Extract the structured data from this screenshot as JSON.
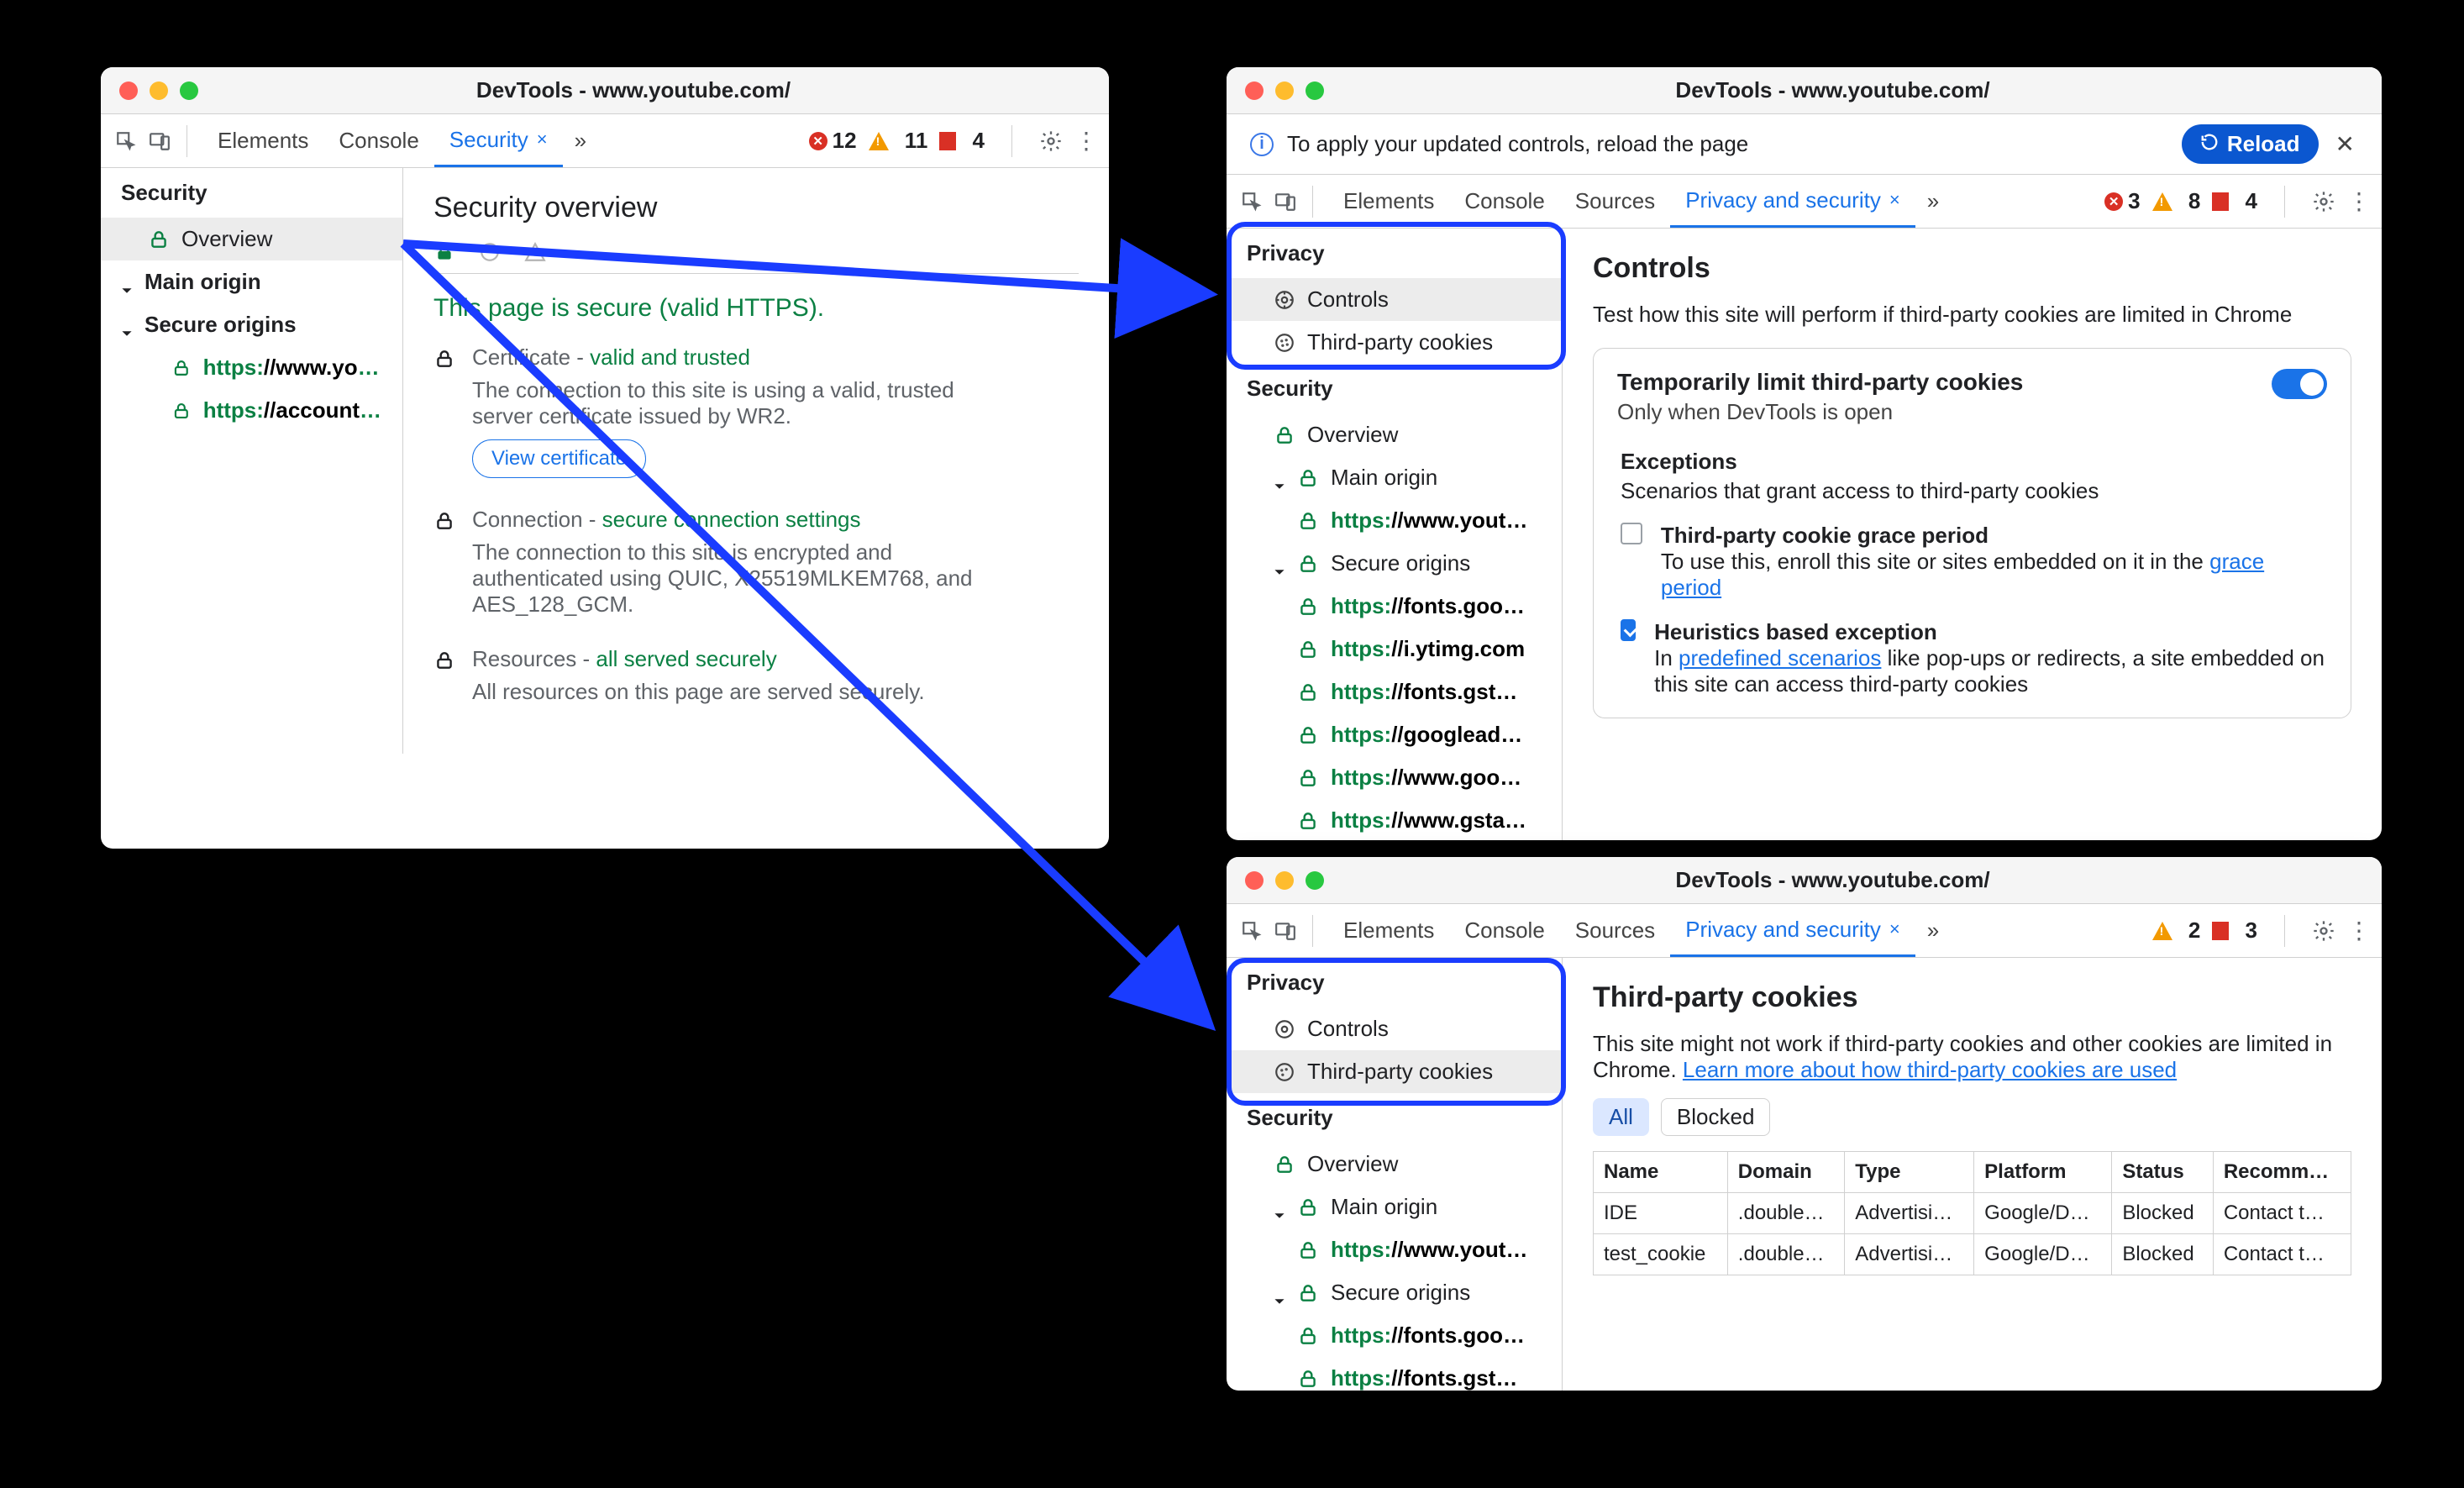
{
  "window_title": "DevTools - www.youtube.com/",
  "panel1": {
    "tabs": {
      "elements": "Elements",
      "console": "Console",
      "security": "Security"
    },
    "badges": {
      "errors": "12",
      "warnings": "11",
      "issues": "4"
    },
    "sidebar": {
      "security_label": "Security",
      "overview": "Overview",
      "main_origin": "Main origin",
      "secure_origins": "Secure origins",
      "origins": [
        {
          "scheme": "https:",
          "rest": "//www.yout…"
        },
        {
          "scheme": "https:",
          "rest": "//accounts.…"
        }
      ]
    },
    "content": {
      "heading": "Security overview",
      "secure_line": "This page is secure (valid HTTPS).",
      "cert_head_prefix": "Certificate - ",
      "cert_head_green": "valid and trusted",
      "cert_sub": "The connection to this site is using a valid, trusted server certificate issued by WR2.",
      "view_cert": "View certificate",
      "conn_head_prefix": "Connection - ",
      "conn_head_green": "secure connection settings",
      "conn_sub": "The connection to this site is encrypted and authenticated using QUIC, X25519MLKEM768, and AES_128_GCM.",
      "res_head_prefix": "Resources - ",
      "res_head_green": "all served securely",
      "res_sub": "All resources on this page are served securely."
    }
  },
  "panel2": {
    "banner": {
      "text": "To apply your updated controls, reload the page",
      "reload": "Reload"
    },
    "tabs": {
      "elements": "Elements",
      "console": "Console",
      "sources": "Sources",
      "privsec": "Privacy and security"
    },
    "badges": {
      "errors": "3",
      "warnings": "8",
      "issues": "4"
    },
    "sidebar": {
      "privacy": "Privacy",
      "controls": "Controls",
      "third_party": "Third-party cookies",
      "security_label": "Security",
      "overview": "Overview",
      "main_origin": "Main origin",
      "main_origin_url": {
        "scheme": "https:",
        "rest": "//www.yout…"
      },
      "secure_origins": "Secure origins",
      "secure_list": [
        {
          "scheme": "https:",
          "rest": "//fonts.goo…"
        },
        {
          "scheme": "https:",
          "rest": "//i.ytimg.com"
        },
        {
          "scheme": "https:",
          "rest": "//fonts.gst…"
        },
        {
          "scheme": "https:",
          "rest": "//googlead…"
        },
        {
          "scheme": "https:",
          "rest": "//www.goo…"
        },
        {
          "scheme": "https:",
          "rest": "//www.gsta…"
        }
      ]
    },
    "content": {
      "heading": "Controls",
      "desc": "Test how this site will perform if third-party cookies are limited in Chrome",
      "card_title": "Temporarily limit third-party cookies",
      "card_sub": "Only when DevTools is open",
      "exceptions_title": "Exceptions",
      "exceptions_sub": "Scenarios that grant access to third-party cookies",
      "exc1_title": "Third-party cookie grace period",
      "exc1_body1": "To use this, enroll this site or sites embedded on it in the ",
      "exc1_link": "grace period",
      "exc2_title": "Heuristics based exception",
      "exc2_body1": "In ",
      "exc2_link": "predefined scenarios",
      "exc2_body2": " like pop-ups or redirects, a site embedded on this site can access third-party cookies"
    }
  },
  "panel3": {
    "tabs": {
      "elements": "Elements",
      "console": "Console",
      "sources": "Sources",
      "privsec": "Privacy and security"
    },
    "badges": {
      "warnings": "2",
      "issues": "3"
    },
    "sidebar": {
      "privacy": "Privacy",
      "controls": "Controls",
      "third_party": "Third-party cookies",
      "security_label": "Security",
      "overview": "Overview",
      "main_origin": "Main origin",
      "main_origin_url": {
        "scheme": "https:",
        "rest": "//www.yout…"
      },
      "secure_origins": "Secure origins",
      "secure_list": [
        {
          "scheme": "https:",
          "rest": "//fonts.goo…"
        },
        {
          "scheme": "https:",
          "rest": "//fonts.gst…"
        }
      ]
    },
    "content": {
      "heading": "Third-party cookies",
      "desc1": "This site might not work if third-party cookies and other cookies are limited in Chrome. ",
      "desc_link": "Learn more about how third-party cookies are used",
      "filters": {
        "all": "All",
        "blocked": "Blocked"
      },
      "columns": [
        "Name",
        "Domain",
        "Type",
        "Platform",
        "Status",
        "Recomm…"
      ],
      "rows": [
        [
          "IDE",
          ".double…",
          "Advertisi…",
          "Google/D…",
          "Blocked",
          "Contact t…"
        ],
        [
          "test_cookie",
          ".double…",
          "Advertisi…",
          "Google/D…",
          "Blocked",
          "Contact t…"
        ]
      ]
    }
  }
}
